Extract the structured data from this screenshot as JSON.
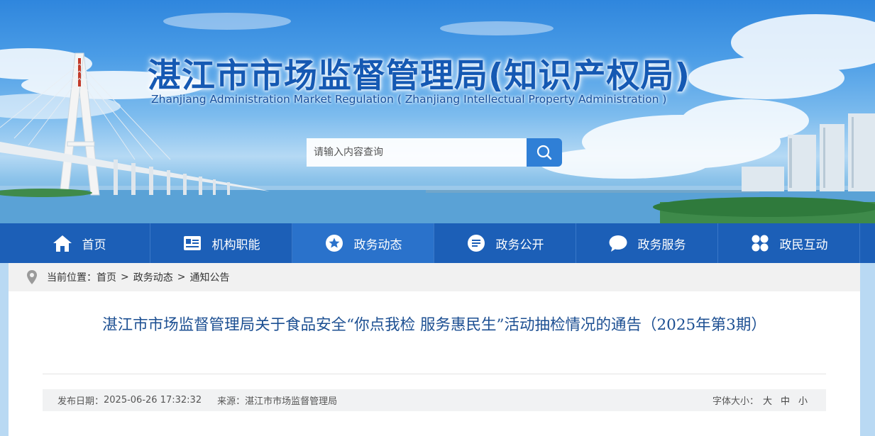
{
  "header": {
    "title": "湛江市市场监督管理局(知识产权局)",
    "subtitle": "Zhanjiang Administration Market Regulation ( Zhanjiang Intellectual Property Administration )"
  },
  "search": {
    "placeholder": "请输入内容查询",
    "icon": "search-icon"
  },
  "nav": {
    "items": [
      {
        "label": "首页",
        "icon": "home-icon"
      },
      {
        "label": "机构职能",
        "icon": "id-card-icon"
      },
      {
        "label": "政务动态",
        "icon": "star-icon"
      },
      {
        "label": "政务公开",
        "icon": "list-icon"
      },
      {
        "label": "政务服务",
        "icon": "chat-icon"
      },
      {
        "label": "政民互动",
        "icon": "grid-icon"
      }
    ],
    "active_index": 2
  },
  "breadcrumb": {
    "prefix": "当前位置：",
    "items": [
      "首页",
      "政务动态",
      "通知公告"
    ],
    "separator": ">"
  },
  "article": {
    "title": "湛江市市场监督管理局关于食品安全“你点我检 服务惠民生”活动抽检情况的通告（2025年第3期）",
    "publish_label": "发布日期：",
    "publish_date": "2025-06-26 17:32:32",
    "source_label": "来源：",
    "source": "湛江市市场监督管理局",
    "font_size_label": "字体大小：",
    "font_sizes": [
      "大",
      "中",
      "小"
    ]
  },
  "colors": {
    "nav_bg": "#1c5fb7",
    "nav_active": "#2a72cb",
    "title_blue": "#1559b3",
    "article_title": "#1c4f92",
    "search_button": "#2f7fd6"
  }
}
